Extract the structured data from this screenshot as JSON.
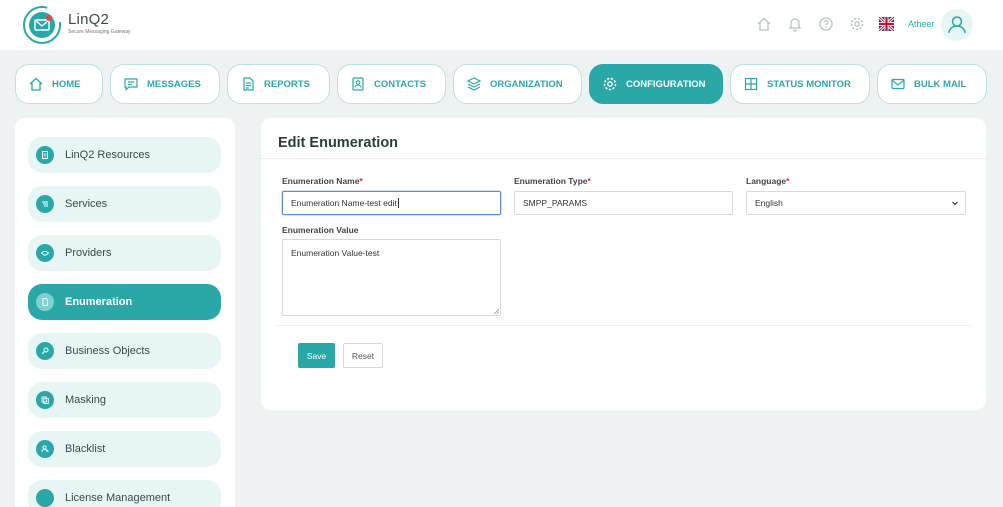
{
  "app": {
    "logo_title": "LinQ2",
    "logo_subtitle": "Secure Messaging Gateway"
  },
  "header": {
    "user_name": "Atheer",
    "icons": [
      "home-icon",
      "bell-icon",
      "help-icon",
      "gear-icon",
      "uk-flag-icon",
      "user-avatar-icon"
    ]
  },
  "nav": {
    "tabs": [
      {
        "label": "HOME",
        "icon": "home-icon"
      },
      {
        "label": "MESSAGES",
        "icon": "message-icon"
      },
      {
        "label": "REPORTS",
        "icon": "document-icon"
      },
      {
        "label": "CONTACTS",
        "icon": "contact-icon"
      },
      {
        "label": "ORGANIZATION",
        "icon": "layers-icon"
      },
      {
        "label": "CONFIGURATION",
        "icon": "gear-icon",
        "active": true
      },
      {
        "label": "STATUS MONITOR",
        "icon": "grid-icon"
      },
      {
        "label": "BULK MAIL",
        "icon": "mail-icon"
      }
    ]
  },
  "sidebar": {
    "items": [
      {
        "label": "LinQ2 Resources",
        "icon": "resources-icon"
      },
      {
        "label": "Services",
        "icon": "list-icon"
      },
      {
        "label": "Providers",
        "icon": "handshake-icon"
      },
      {
        "label": "Enumeration",
        "icon": "file-icon",
        "active": true
      },
      {
        "label": "Business Objects",
        "icon": "key-icon"
      },
      {
        "label": "Masking",
        "icon": "copy-icon"
      },
      {
        "label": "Blacklist",
        "icon": "user-block-icon"
      },
      {
        "label": "License Management",
        "icon": "license-icon"
      }
    ]
  },
  "form": {
    "title": "Edit Enumeration",
    "name_label": "Enumeration Name",
    "name_value": "Enumeration Name-test edit",
    "type_label": "Enumeration Type",
    "type_value": "SMPP_PARAMS",
    "language_label": "Language",
    "language_value": "English",
    "value_label": "Enumeration Value",
    "value_value": "Enumeration Value-test",
    "required_mark": "*",
    "save_label": "Save",
    "reset_label": "Reset"
  },
  "colors": {
    "accent": "#2aa8a8",
    "accent_light": "#e8f5f5",
    "background": "#eef2f2",
    "required": "#dd2222"
  }
}
